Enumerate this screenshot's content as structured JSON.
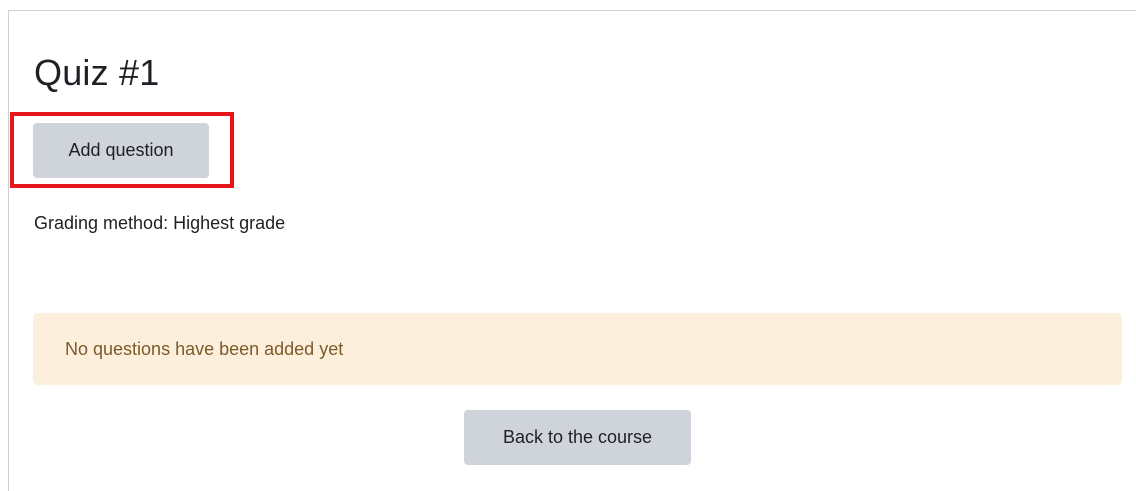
{
  "quiz": {
    "title": "Quiz #1",
    "add_question_label": "Add question",
    "grading_method_text": "Grading method: Highest grade",
    "empty_notice": "No questions have been added yet",
    "back_label": "Back to the course"
  },
  "colors": {
    "button_bg": "#ced4da",
    "notice_bg": "#fcefdc",
    "notice_text": "#7d5a29",
    "highlight": "#e8161b"
  }
}
